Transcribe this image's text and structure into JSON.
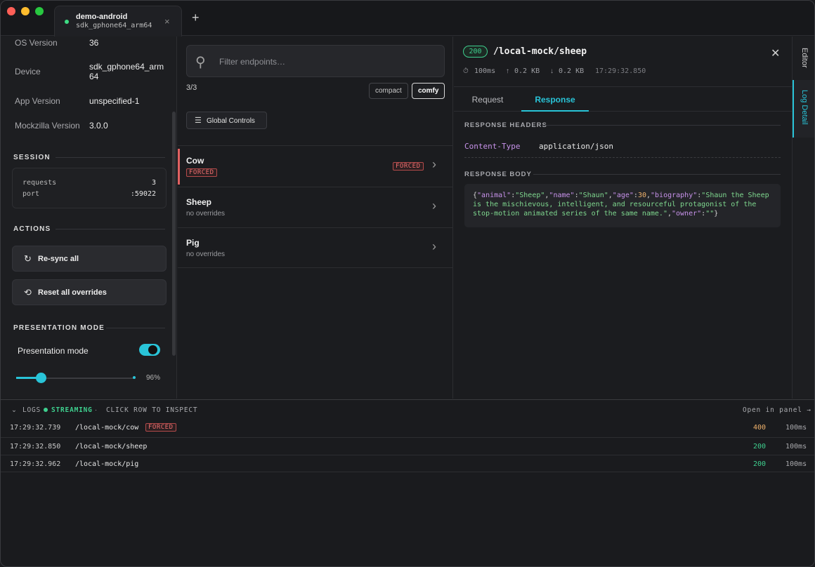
{
  "tab": {
    "title": "demo-android",
    "subtitle": "sdk_gphone64_arm64",
    "close": "×",
    "new_tab": "+"
  },
  "device_info": [
    {
      "key": "OS Version",
      "value": "36"
    },
    {
      "key": "Device",
      "value": "sdk_gphone64_arm64"
    },
    {
      "key": "App Version",
      "value": "unspecified-1"
    },
    {
      "key": "Mockzilla Version",
      "value": "3.0.0"
    }
  ],
  "session": {
    "heading": "SESSION",
    "rows": [
      {
        "key": "requests",
        "value": "3"
      },
      {
        "key": "port",
        "value": ":59022"
      }
    ]
  },
  "actions": {
    "heading": "ACTIONS",
    "resync": "Re-sync all",
    "reset": "Reset all overrides"
  },
  "presentation": {
    "heading": "PRESENTATION MODE",
    "label": "Presentation mode",
    "enabled": true,
    "zoom_fraction": 0.96,
    "zoom_label": "96%"
  },
  "endpoints": {
    "filter_placeholder": "Filter endpoints…",
    "count": "3/3",
    "density_options": [
      "compact",
      "comfy"
    ],
    "density_selected": "comfy",
    "global_controls": "Global Controls",
    "items": [
      {
        "name": "Cow",
        "sub": "FORCED",
        "forced": true,
        "badge": "FORCED"
      },
      {
        "name": "Sheep",
        "sub": "no overrides",
        "forced": false
      },
      {
        "name": "Pig",
        "sub": "no overrides",
        "forced": false
      }
    ]
  },
  "detail": {
    "status": "200",
    "path": "/local-mock/sheep",
    "duration": "100ms",
    "upload": "0.2 KB",
    "download": "0.2 KB",
    "time": "17:29:32.850",
    "tabs": [
      "Request",
      "Response"
    ],
    "active_tab": "Response",
    "headers_title": "RESPONSE HEADERS",
    "header_key": "Content-Type",
    "header_value": "application/json",
    "body_title": "RESPONSE BODY",
    "body": {
      "animal": "Sheep",
      "name": "Shaun",
      "age": "30",
      "biography": "Shaun the Sheep is the mischievous, intelligent, and resourceful protagonist of the stop-motion animated series of the same name.",
      "owner": ""
    }
  },
  "rail": {
    "editor": "Editor",
    "log_detail": "Log Detail"
  },
  "logs": {
    "title": "LOGS",
    "streaming": "STREAMING",
    "hint": "CLICK ROW TO INSPECT",
    "open_panel": "Open in panel →",
    "rows": [
      {
        "time": "17:29:32.739",
        "path": "/local-mock/cow",
        "badge": "FORCED",
        "status": "400",
        "duration": "100ms"
      },
      {
        "time": "17:29:32.850",
        "path": "/local-mock/sheep",
        "badge": "",
        "status": "200",
        "duration": "100ms"
      },
      {
        "time": "17:29:32.962",
        "path": "/local-mock/pig",
        "badge": "",
        "status": "200",
        "duration": "100ms"
      }
    ]
  },
  "colors": {
    "accent": "#29c4d8",
    "success": "#3ecf8e",
    "error": "#e06161",
    "warning": "#f0b26b"
  }
}
